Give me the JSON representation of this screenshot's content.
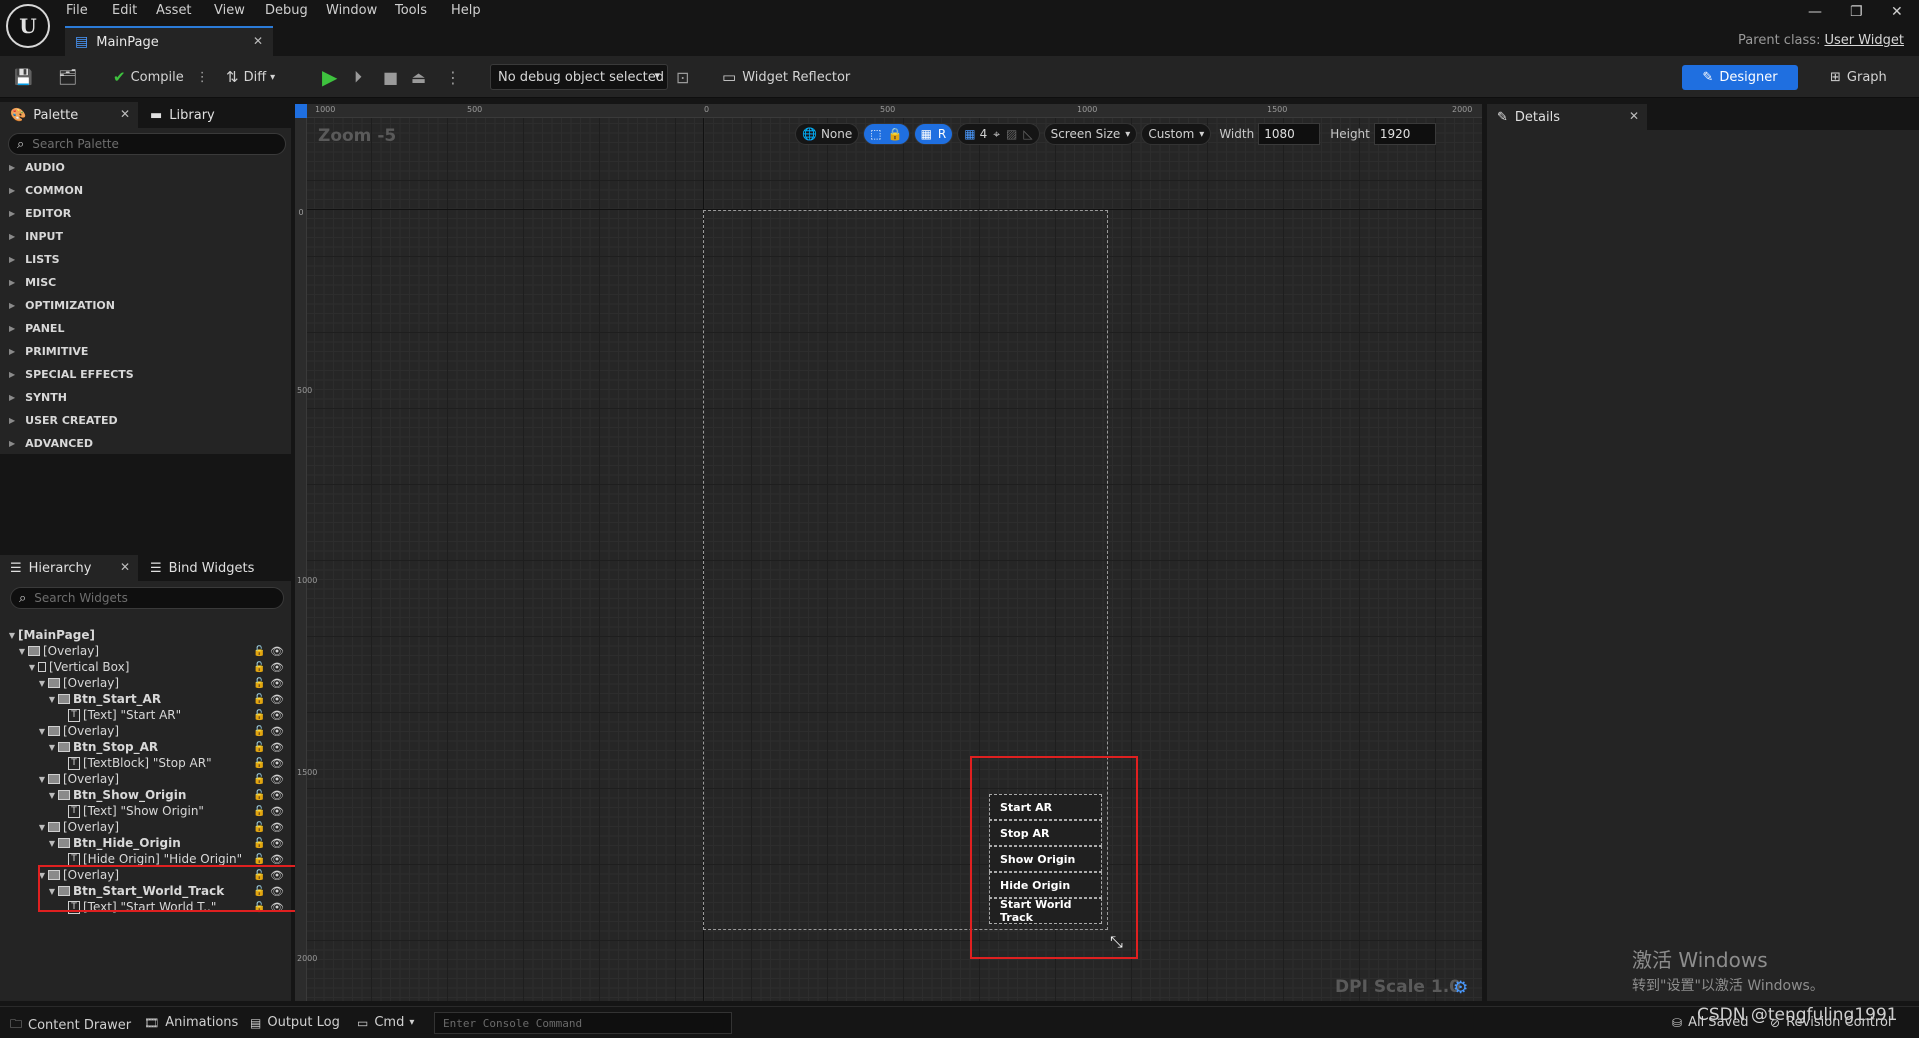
{
  "menubar": {
    "logo": "U",
    "items": [
      "File",
      "Edit",
      "Asset",
      "View",
      "Debug",
      "Window",
      "Tools",
      "Help"
    ],
    "window_controls": [
      "—",
      "❐",
      "✕"
    ]
  },
  "tabbar": {
    "doc_tab": "MainPage",
    "parent_class_label": "Parent class:",
    "parent_class_value": "User Widget"
  },
  "toolbar": {
    "compile_label": "Compile",
    "diff_label": "Diff",
    "debug_select": "No debug object selected",
    "widget_reflector_label": "Widget Reflector",
    "designer_label": "Designer",
    "graph_label": "Graph"
  },
  "palette": {
    "tab_label": "Palette",
    "library_label": "Library",
    "search_placeholder": "Search Palette",
    "categories": [
      "AUDIO",
      "COMMON",
      "EDITOR",
      "INPUT",
      "LISTS",
      "MISC",
      "OPTIMIZATION",
      "PANEL",
      "PRIMITIVE",
      "SPECIAL EFFECTS",
      "SYNTH",
      "USER CREATED",
      "ADVANCED"
    ]
  },
  "hierarchy": {
    "tab_label": "Hierarchy",
    "bind_label": "Bind Widgets",
    "search_placeholder": "Search Widgets",
    "rows": [
      {
        "label": "[MainPage]",
        "bold": true
      },
      {
        "label": "[Overlay]"
      },
      {
        "label": "[Vertical Box]"
      },
      {
        "label": "[Overlay]"
      },
      {
        "label": "Btn_Start_AR",
        "bold": true
      },
      {
        "label": "[Text] \"Start AR\""
      },
      {
        "label": "[Overlay]"
      },
      {
        "label": "Btn_Stop_AR",
        "bold": true
      },
      {
        "label": "[TextBlock] \"Stop AR\""
      },
      {
        "label": "[Overlay]"
      },
      {
        "label": "Btn_Show_Origin",
        "bold": true
      },
      {
        "label": "[Text] \"Show Origin\""
      },
      {
        "label": "[Overlay]"
      },
      {
        "label": "Btn_Hide_Origin",
        "bold": true
      },
      {
        "label": "[Hide Origin] \"Hide Origin\""
      },
      {
        "label": "[Overlay]"
      },
      {
        "label": "Btn_Start_World_Track",
        "bold": true
      },
      {
        "label": "[Text] \"Start World T..\""
      }
    ]
  },
  "canvas": {
    "zoom_label": "Zoom -5",
    "dpi_label": "DPI Scale 1.0",
    "ruler_top": [
      "1000",
      "500",
      "0",
      "500",
      "1000",
      "1500",
      "2000"
    ],
    "ruler_left": [
      "0",
      "500",
      "1000",
      "1500",
      "2000"
    ],
    "toolbar": {
      "none_label": "None",
      "r_label": "R",
      "grid_count": "4",
      "screen_size": "Screen Size",
      "custom": "Custom",
      "width_label": "Width",
      "width_value": "1080",
      "height_label": "Height",
      "height_value": "1920"
    },
    "buttons": [
      "Start AR",
      "Stop AR",
      "Show Origin",
      "Hide Origin",
      "Start World Track"
    ]
  },
  "details": {
    "tab_label": "Details"
  },
  "watermark": {
    "activate_title": "激活 Windows",
    "activate_sub": "转到\"设置\"以激活 Windows。",
    "csdn": "CSDN @tengfuling1991"
  },
  "bottombar": {
    "content_drawer": "Content Drawer",
    "animations": "Animations",
    "output_log": "Output Log",
    "cmd": "Cmd",
    "console_placeholder": "Enter Console Command",
    "all_saved": "All Saved",
    "revision_control": "Revision Control"
  },
  "colors": {
    "accent": "#1f6fe0",
    "highlight_box": "#e02020",
    "play": "#3ec23e"
  }
}
